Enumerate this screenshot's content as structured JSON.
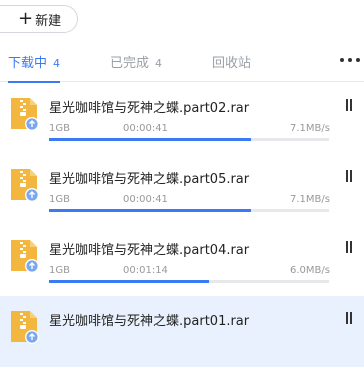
{
  "toolbar": {
    "new_label": "新建"
  },
  "tabs": [
    {
      "label": "下载中",
      "count": "4",
      "active": true
    },
    {
      "label": "已完成",
      "count": "4",
      "active": false
    },
    {
      "label": "回收站",
      "count": "",
      "active": false
    }
  ],
  "colors": {
    "accent": "#3a7af2",
    "zip_yellow": "#f3b63f",
    "selected_bg": "#e8f1fd"
  },
  "icons": {
    "file": "zip-file-cloud-icon",
    "pause": "pause-icon",
    "more": "more-icon",
    "add": "plus-icon"
  },
  "downloads": [
    {
      "name": "星光咖啡馆与死神之蝶.part02.rar",
      "size": "1GB",
      "time": "00:00:41",
      "speed": "7.1MB/s",
      "progress": 0.72
    },
    {
      "name": "星光咖啡馆与死神之蝶.part05.rar",
      "size": "1GB",
      "time": "00:00:41",
      "speed": "7.1MB/s",
      "progress": 0.72
    },
    {
      "name": "星光咖啡馆与死神之蝶.part04.rar",
      "size": "1GB",
      "time": "00:01:14",
      "speed": "6.0MB/s",
      "progress": 0.57
    },
    {
      "name": "星光咖啡馆与死神之蝶.part01.rar",
      "size": "",
      "time": "",
      "speed": "",
      "progress": null,
      "selected": true
    }
  ]
}
